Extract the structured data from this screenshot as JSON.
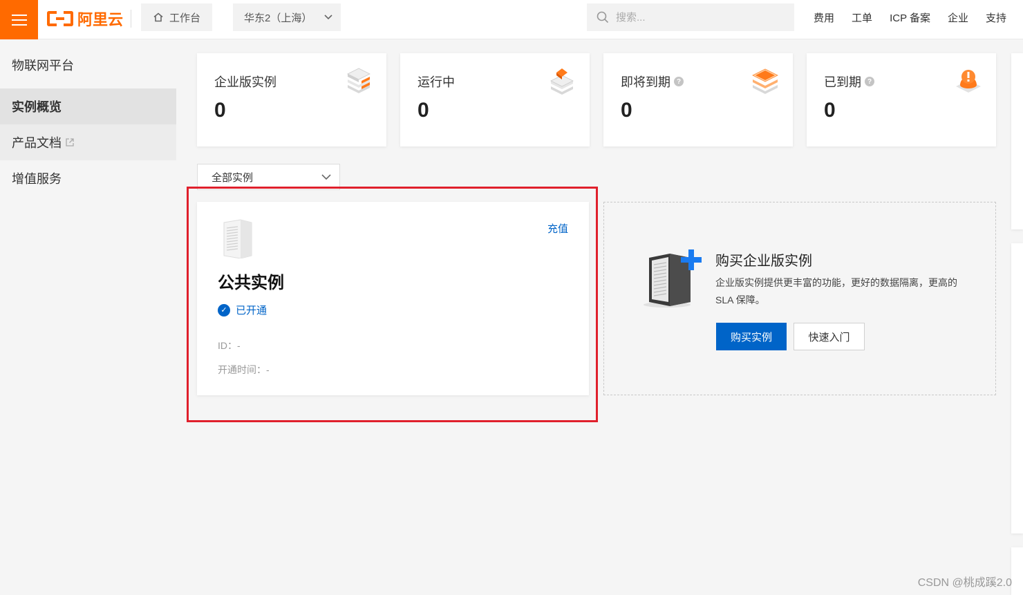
{
  "topbar": {
    "logo_text": "阿里云",
    "workbench_label": "工作台",
    "region_label": "华东2（上海）",
    "search_placeholder": "搜索...",
    "nav": [
      "费用",
      "工单",
      "ICP 备案",
      "企业",
      "支持"
    ]
  },
  "sidebar": {
    "title": "物联网平台",
    "items": [
      {
        "label": "实例概览",
        "active": true
      },
      {
        "label": "产品文档",
        "external": true
      },
      {
        "label": "增值服务"
      }
    ]
  },
  "stats": [
    {
      "label": "企业版实例",
      "value": "0",
      "help": false,
      "icon": "stack-layers-icon"
    },
    {
      "label": "运行中",
      "value": "0",
      "help": false,
      "icon": "running-stack-icon"
    },
    {
      "label": "即将到期",
      "value": "0",
      "help": true,
      "icon": "expiring-stack-icon"
    },
    {
      "label": "已到期",
      "value": "0",
      "help": true,
      "icon": "expired-alert-icon"
    }
  ],
  "filter": {
    "selected": "全部实例"
  },
  "public_instance": {
    "title": "公共实例",
    "status": "已开通",
    "recharge": "充值",
    "id_label": "ID：",
    "id_value": "-",
    "open_time_label": "开通时间：",
    "open_time_value": "-"
  },
  "buy_enterprise": {
    "title": "购买企业版实例",
    "description": "企业版实例提供更丰富的功能，更好的数据隔离，更高的 SLA 保障。",
    "buy_button": "购买实例",
    "quickstart_button": "快速入门"
  },
  "watermark": "CSDN @桃成蹊2.0",
  "colors": {
    "brand": "#ff6a00",
    "primary": "#0064c8",
    "highlight": "#e0202c"
  }
}
